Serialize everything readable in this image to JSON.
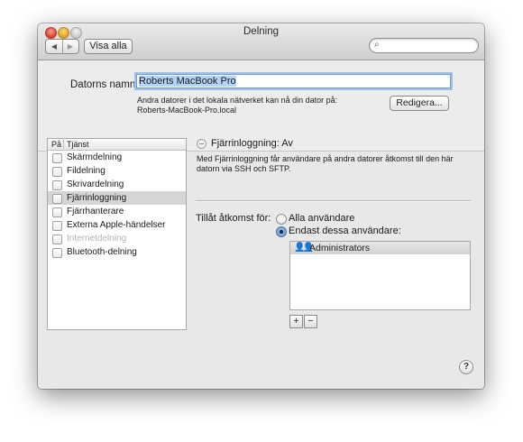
{
  "window": {
    "title": "Delning"
  },
  "toolbar": {
    "back_icon": "◀",
    "forward_icon": "▶",
    "show_all_label": "Visa alla",
    "search_icon": "⌕",
    "search_value": ""
  },
  "computer_name": {
    "label": "Datorns namn:",
    "value": "Roberts MacBook Pro",
    "info_line1": "Andra datorer i det lokala nätverket kan nå din dator på:",
    "info_line2": "Roberts-MacBook-Pro.local",
    "edit_label": "Redigera..."
  },
  "services": {
    "header_on": "På",
    "header_service": "Tjänst",
    "items": [
      {
        "label": "Skärmdelning",
        "checked": false,
        "selected": false,
        "enabled": true
      },
      {
        "label": "Fildelning",
        "checked": false,
        "selected": false,
        "enabled": true
      },
      {
        "label": "Skrivardelning",
        "checked": false,
        "selected": false,
        "enabled": true
      },
      {
        "label": "Fjärrinloggning",
        "checked": false,
        "selected": true,
        "enabled": true
      },
      {
        "label": "Fjärrhanterare",
        "checked": false,
        "selected": false,
        "enabled": true
      },
      {
        "label": "Externa Apple-händelser",
        "checked": false,
        "selected": false,
        "enabled": true
      },
      {
        "label": "Internetdelning",
        "checked": false,
        "selected": false,
        "enabled": false
      },
      {
        "label": "Bluetooth-delning",
        "checked": false,
        "selected": false,
        "enabled": true
      }
    ]
  },
  "detail": {
    "status": "Fjärrinloggning: Av",
    "description_line1": "Med Fjärrinloggning får användare på andra datorer åtkomst till den här",
    "description_line2": "datorn via SSH och SFTP.",
    "access_label": "Tillåt åtkomst för:",
    "option_all": "Alla användare",
    "option_only": "Endast dessa användare:",
    "selected_option": "only",
    "users": [
      {
        "name": "Administrators",
        "icon": "group-icon"
      }
    ],
    "add_label": "+",
    "remove_label": "−"
  },
  "help_label": "?"
}
